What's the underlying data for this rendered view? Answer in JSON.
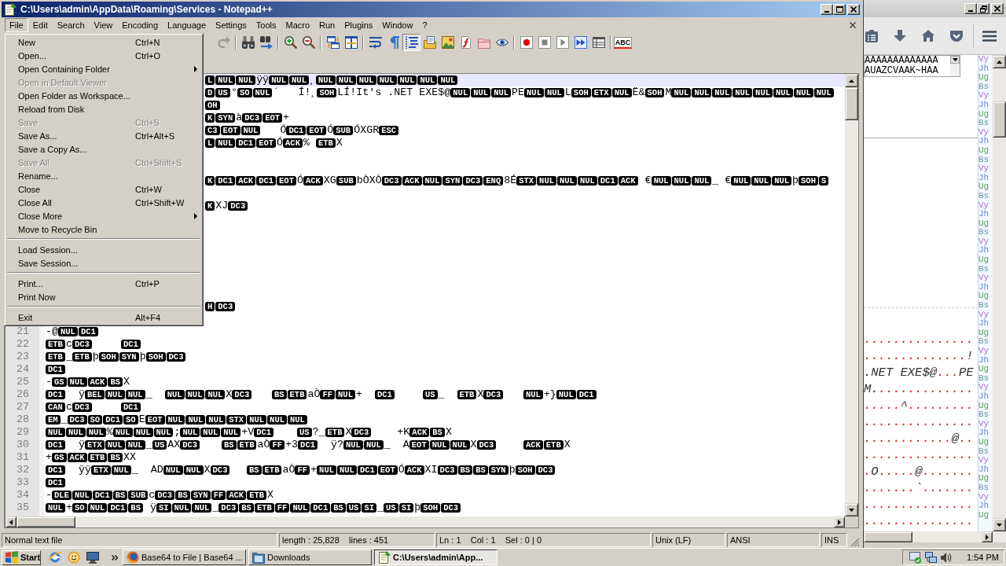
{
  "window": {
    "title": "C:\\Users\\admin\\AppData\\Roaming\\Services - Notepad++"
  },
  "menu_bar": [
    {
      "label": "File",
      "selected": true
    },
    {
      "label": "Edit",
      "selected": false
    },
    {
      "label": "Search",
      "selected": false
    },
    {
      "label": "View",
      "selected": false
    },
    {
      "label": "Encoding",
      "selected": false
    },
    {
      "label": "Language",
      "selected": false
    },
    {
      "label": "Settings",
      "selected": false
    },
    {
      "label": "Tools",
      "selected": false
    },
    {
      "label": "Macro",
      "selected": false
    },
    {
      "label": "Run",
      "selected": false
    },
    {
      "label": "Plugins",
      "selected": false
    },
    {
      "label": "Window",
      "selected": false
    },
    {
      "label": "?",
      "selected": false
    }
  ],
  "toolbar": [
    {
      "pressed": false,
      "disabled": true
    },
    {
      "pressed": false,
      "disabled": false
    },
    {
      "pressed": false,
      "disabled": false
    },
    {
      "pressed": false,
      "disabled": false
    },
    {
      "pressed": false,
      "disabled": false
    },
    {
      "pressed": false,
      "disabled": false
    },
    {
      "pressed": false,
      "disabled": false
    },
    {
      "pressed": false,
      "disabled": false
    },
    {
      "pressed": false,
      "disabled": false
    },
    {
      "pressed": true,
      "disabled": false
    },
    {
      "pressed": false,
      "disabled": false
    },
    {
      "pressed": false,
      "disabled": false
    },
    {
      "pressed": false,
      "disabled": false
    },
    {
      "pressed": false,
      "disabled": false
    },
    {
      "pressed": false,
      "disabled": false
    },
    {
      "pressed": false,
      "disabled": false
    },
    {
      "pressed": false,
      "disabled": false
    },
    {
      "pressed": false,
      "disabled": false
    },
    {
      "pressed": false,
      "disabled": false
    },
    {
      "pressed": false,
      "disabled": false
    },
    {
      "pressed": false,
      "disabled": false,
      "label": "ABC"
    }
  ],
  "file_menu": [
    {
      "kind": "item",
      "label": "New",
      "shortcut": "Ctrl+N",
      "disabled": false,
      "submenu": false
    },
    {
      "kind": "item",
      "label": "Open...",
      "shortcut": "Ctrl+O",
      "disabled": false,
      "submenu": false
    },
    {
      "kind": "item",
      "label": "Open Containing Folder",
      "disabled": false,
      "submenu": true
    },
    {
      "kind": "item",
      "label": "Open in Default Viewer",
      "disabled": true,
      "submenu": false
    },
    {
      "kind": "item",
      "label": "Open Folder as Workspace...",
      "disabled": false,
      "submenu": false
    },
    {
      "kind": "item",
      "label": "Reload from Disk",
      "disabled": false,
      "submenu": false
    },
    {
      "kind": "item",
      "label": "Save",
      "shortcut": "Ctrl+S",
      "disabled": true,
      "submenu": false
    },
    {
      "kind": "item",
      "label": "Save As...",
      "shortcut": "Ctrl+Alt+S",
      "disabled": false,
      "submenu": false
    },
    {
      "kind": "item",
      "label": "Save a Copy As...",
      "disabled": false,
      "submenu": false
    },
    {
      "kind": "item",
      "label": "Save All",
      "shortcut": "Ctrl+Shift+S",
      "disabled": true,
      "submenu": false
    },
    {
      "kind": "item",
      "label": "Rename...",
      "disabled": false,
      "submenu": false
    },
    {
      "kind": "item",
      "label": "Close",
      "shortcut": "Ctrl+W",
      "disabled": false,
      "submenu": false
    },
    {
      "kind": "item",
      "label": "Close All",
      "shortcut": "Ctrl+Shift+W",
      "disabled": false,
      "submenu": false
    },
    {
      "kind": "item",
      "label": "Close More",
      "disabled": false,
      "submenu": true
    },
    {
      "kind": "item",
      "label": "Move to Recycle Bin",
      "disabled": false,
      "submenu": false
    },
    {
      "kind": "separator"
    },
    {
      "kind": "item",
      "label": "Load Session...",
      "disabled": false,
      "submenu": false
    },
    {
      "kind": "item",
      "label": "Save Session...",
      "disabled": false,
      "submenu": false
    },
    {
      "kind": "separator"
    },
    {
      "kind": "item",
      "label": "Print...",
      "shortcut": "Ctrl+P",
      "disabled": false,
      "submenu": false
    },
    {
      "kind": "item",
      "label": "Print Now",
      "disabled": false,
      "submenu": false
    },
    {
      "kind": "separator"
    },
    {
      "kind": "item",
      "label": "Exit",
      "shortcut": "Alt+F4",
      "disabled": false,
      "submenu": false
    }
  ],
  "editor": {
    "lines": [
      {
        "current": true,
        "segments": [
          {
            "kind": "ctrl",
            "text": "L"
          },
          {
            "kind": "ctrl",
            "text": "NUL"
          },
          {
            "kind": "ctrl",
            "text": "NUL"
          },
          {
            "kind": "chars",
            "text": "ÿÿ"
          },
          {
            "kind": "ctrl",
            "text": "NUL"
          },
          {
            "kind": "ctrl",
            "text": "NUL"
          },
          {
            "kind": "chars",
            "text": "¸"
          },
          {
            "kind": "ctrl",
            "text": "NUL"
          },
          {
            "kind": "ctrl",
            "text": "NUL"
          },
          {
            "kind": "ctrl",
            "text": "NUL"
          },
          {
            "kind": "ctrl",
            "text": "NUL"
          },
          {
            "kind": "ctrl",
            "text": "NUL"
          },
          {
            "kind": "ctrl",
            "text": "NUL"
          },
          {
            "kind": "ctrl",
            "text": "NUL"
          }
        ]
      },
      {
        "current": false,
        "segments": [
          {
            "kind": "ctrl",
            "text": "D"
          },
          {
            "kind": "ctrl",
            "text": "US"
          },
          {
            "kind": "chars",
            "text": "°"
          },
          {
            "kind": "ctrl",
            "text": "SO"
          },
          {
            "kind": "ctrl",
            "text": "NUL"
          },
          {
            "kind": "chars",
            "text": "´   Í!¸"
          },
          {
            "kind": "ctrl",
            "text": "SOH"
          },
          {
            "kind": "chars",
            "text": "LÍ!It's .NET EXE$@"
          },
          {
            "kind": "ctrl",
            "text": "NUL"
          },
          {
            "kind": "ctrl",
            "text": "NUL"
          },
          {
            "kind": "ctrl",
            "text": "NUL"
          },
          {
            "kind": "chars",
            "text": "PE"
          },
          {
            "kind": "ctrl",
            "text": "NUL"
          },
          {
            "kind": "ctrl",
            "text": "NUL"
          },
          {
            "kind": "chars",
            "text": "L"
          },
          {
            "kind": "ctrl",
            "text": "SOH"
          },
          {
            "kind": "ctrl",
            "text": "ETX"
          },
          {
            "kind": "ctrl",
            "text": "NUL"
          },
          {
            "kind": "chars",
            "text": "Ë&"
          },
          {
            "kind": "ctrl",
            "text": "SOH"
          },
          {
            "kind": "chars",
            "text": "M"
          },
          {
            "kind": "ctrl",
            "text": "NUL"
          },
          {
            "kind": "ctrl",
            "text": "NUL"
          },
          {
            "kind": "ctrl",
            "text": "NUL"
          },
          {
            "kind": "ctrl",
            "text": "NUL"
          },
          {
            "kind": "ctrl",
            "text": "NUL"
          },
          {
            "kind": "ctrl",
            "text": "NUL"
          },
          {
            "kind": "ctrl",
            "text": "NUL"
          },
          {
            "kind": "ctrl",
            "text": "NUL"
          }
        ]
      },
      {
        "current": false,
        "segments": [
          {
            "kind": "ctrl",
            "text": "OH"
          }
        ]
      },
      {
        "current": false,
        "segments": [
          {
            "kind": "ctrl",
            "text": "K"
          },
          {
            "kind": "ctrl",
            "text": "SYN"
          },
          {
            "kind": "chars",
            "text": "à"
          },
          {
            "kind": "ctrl",
            "text": "DC3"
          },
          {
            "kind": "ctrl",
            "text": "EOT"
          },
          {
            "kind": "chars",
            "text": "+"
          }
        ]
      },
      {
        "current": false,
        "segments": [
          {
            "kind": "ctrl",
            "text": "C3"
          },
          {
            "kind": "ctrl",
            "text": "EOT"
          },
          {
            "kind": "ctrl",
            "text": "NUL"
          },
          {
            "kind": "chars",
            "text": "   Ó"
          },
          {
            "kind": "ctrl",
            "text": "DC1"
          },
          {
            "kind": "ctrl",
            "text": "EOT"
          },
          {
            "kind": "chars",
            "text": "Ó"
          },
          {
            "kind": "ctrl",
            "text": "SUB"
          },
          {
            "kind": "chars",
            "text": "ÓXGR"
          },
          {
            "kind": "ctrl",
            "text": "ESC"
          }
        ]
      },
      {
        "current": false,
        "segments": [
          {
            "kind": "ctrl",
            "text": "L"
          },
          {
            "kind": "ctrl",
            "text": "NUL"
          },
          {
            "kind": "ctrl",
            "text": "DC1"
          },
          {
            "kind": "ctrl",
            "text": "EOT"
          },
          {
            "kind": "chars",
            "text": "Ó"
          },
          {
            "kind": "ctrl",
            "text": "ACK"
          },
          {
            "kind": "chars",
            "text": "% "
          },
          {
            "kind": "ctrl",
            "text": "ETB"
          },
          {
            "kind": "chars",
            "text": "X"
          }
        ]
      },
      {
        "current": false
      },
      {
        "current": false
      },
      {
        "current": false,
        "segments": [
          {
            "kind": "ctrl",
            "text": "K"
          },
          {
            "kind": "ctrl",
            "text": "DC1"
          },
          {
            "kind": "ctrl",
            "text": "ACK"
          },
          {
            "kind": "ctrl",
            "text": "DC1"
          },
          {
            "kind": "ctrl",
            "text": "EOT"
          },
          {
            "kind": "chars",
            "text": "Ó"
          },
          {
            "kind": "ctrl",
            "text": "ACK"
          },
          {
            "kind": "chars",
            "text": "XG"
          },
          {
            "kind": "ctrl",
            "text": "SUB"
          },
          {
            "kind": "chars",
            "text": "bÒXÒ"
          },
          {
            "kind": "ctrl",
            "text": "DC3"
          },
          {
            "kind": "ctrl",
            "text": "ACK"
          },
          {
            "kind": "ctrl",
            "text": "NUL"
          },
          {
            "kind": "ctrl",
            "text": "SYN"
          },
          {
            "kind": "ctrl",
            "text": "DC3"
          },
          {
            "kind": "ctrl",
            "text": "ENQ"
          },
          {
            "kind": "chars",
            "text": "8É"
          },
          {
            "kind": "ctrl",
            "text": "STX"
          },
          {
            "kind": "ctrl",
            "text": "NUL"
          },
          {
            "kind": "ctrl",
            "text": "NUL"
          },
          {
            "kind": "ctrl",
            "text": "NUL"
          },
          {
            "kind": "ctrl",
            "text": "DC1"
          },
          {
            "kind": "ctrl",
            "text": "ACK"
          },
          {
            "kind": "chars",
            "text": " €"
          },
          {
            "kind": "ctrl",
            "text": "NUL"
          },
          {
            "kind": "ctrl",
            "text": "NUL"
          },
          {
            "kind": "ctrl",
            "text": "NUL"
          },
          {
            "kind": "chars",
            "text": "_ €"
          },
          {
            "kind": "ctrl",
            "text": "NUL"
          },
          {
            "kind": "ctrl",
            "text": "NUL"
          },
          {
            "kind": "ctrl",
            "text": "NUL"
          },
          {
            "kind": "chars",
            "text": "þ"
          },
          {
            "kind": "ctrl",
            "text": "SOH"
          },
          {
            "kind": "ctrl",
            "text": "S"
          }
        ]
      },
      {
        "current": false
      },
      {
        "current": false,
        "segments": [
          {
            "kind": "ctrl",
            "text": "K"
          },
          {
            "kind": "chars",
            "text": "XJ"
          },
          {
            "kind": "ctrl",
            "text": "DC3"
          }
        ]
      },
      {
        "current": false
      },
      {
        "current": false
      },
      {
        "current": false
      },
      {
        "current": false
      },
      {
        "current": false
      },
      {
        "current": false
      },
      {
        "current": false
      },
      {
        "current": false,
        "segments": [
          {
            "kind": "ctrl",
            "text": "H"
          },
          {
            "kind": "ctrl",
            "text": "DC3"
          }
        ]
      },
      {
        "current": false
      },
      {
        "number": "21",
        "current": false,
        "segments": [
          {
            "kind": "chars",
            "text": "-@"
          },
          {
            "kind": "ctrl",
            "text": "NUL"
          },
          {
            "kind": "ctrl",
            "text": "DC1"
          }
        ]
      },
      {
        "number": "22",
        "current": false,
        "segments": [
          {
            "kind": "ctrl",
            "text": "ETB"
          },
          {
            "kind": "chars",
            "text": "c"
          },
          {
            "kind": "ctrl",
            "text": "DC3"
          },
          {
            "kind": "tab"
          },
          {
            "kind": "tab"
          },
          {
            "kind": "ctrl",
            "text": "DC1"
          }
        ]
      },
      {
        "number": "23",
        "current": false,
        "segments": [
          {
            "kind": "ctrl",
            "text": "ETB"
          },
          {
            "kind": "chars",
            "text": "_"
          },
          {
            "kind": "ctrl",
            "text": "ETB"
          },
          {
            "kind": "chars",
            "text": "þ"
          },
          {
            "kind": "ctrl",
            "text": "SOH"
          },
          {
            "kind": "ctrl",
            "text": "SYN"
          },
          {
            "kind": "chars",
            "text": "þ"
          },
          {
            "kind": "ctrl",
            "text": "SOH"
          },
          {
            "kind": "ctrl",
            "text": "DC3"
          }
        ]
      },
      {
        "number": "24",
        "current": false,
        "segments": [
          {
            "kind": "ctrl",
            "text": "DC1"
          }
        ]
      },
      {
        "number": "25",
        "current": false,
        "segments": [
          {
            "kind": "chars",
            "text": "-"
          },
          {
            "kind": "ctrl",
            "text": "GS"
          },
          {
            "kind": "ctrl",
            "text": "NUL"
          },
          {
            "kind": "ctrl",
            "text": "ACK"
          },
          {
            "kind": "ctrl",
            "text": "BS"
          },
          {
            "kind": "chars",
            "text": "X"
          }
        ]
      },
      {
        "number": "26",
        "current": false,
        "segments": [
          {
            "kind": "ctrl",
            "text": "DC1"
          },
          {
            "kind": "chars",
            "text": "  ÿ"
          },
          {
            "kind": "ctrl",
            "text": "BEL"
          },
          {
            "kind": "ctrl",
            "text": "NUL"
          },
          {
            "kind": "ctrl",
            "text": "NUL"
          },
          {
            "kind": "chars",
            "text": "_  "
          },
          {
            "kind": "ctrl",
            "text": "NUL"
          },
          {
            "kind": "ctrl",
            "text": "NUL"
          },
          {
            "kind": "ctrl",
            "text": "NUL"
          },
          {
            "kind": "chars",
            "text": "X"
          },
          {
            "kind": "ctrl",
            "text": "DC3"
          },
          {
            "kind": "tab"
          },
          {
            "kind": "ctrl",
            "text": "BS"
          },
          {
            "kind": "ctrl",
            "text": "ETB"
          },
          {
            "kind": "chars",
            "text": "aÒ"
          },
          {
            "kind": "ctrl",
            "text": "FF"
          },
          {
            "kind": "ctrl",
            "text": "NUL"
          },
          {
            "kind": "chars",
            "text": "+  "
          },
          {
            "kind": "ctrl",
            "text": "DC1"
          },
          {
            "kind": "tab"
          },
          {
            "kind": "ctrl",
            "text": "US"
          },
          {
            "kind": "chars",
            "text": "_  "
          },
          {
            "kind": "ctrl",
            "text": "ETB"
          },
          {
            "kind": "chars",
            "text": "X"
          },
          {
            "kind": "ctrl",
            "text": "DC3"
          },
          {
            "kind": "tab"
          },
          {
            "kind": "ctrl",
            "text": "NUL"
          },
          {
            "kind": "chars",
            "text": "+}"
          },
          {
            "kind": "ctrl",
            "text": "NUL"
          },
          {
            "kind": "ctrl",
            "text": "DC1"
          }
        ]
      },
      {
        "number": "27",
        "current": false,
        "segments": [
          {
            "kind": "ctrl",
            "text": "CAN"
          },
          {
            "kind": "chars",
            "text": "c"
          },
          {
            "kind": "ctrl",
            "text": "DC3"
          },
          {
            "kind": "tab"
          },
          {
            "kind": "tab"
          },
          {
            "kind": "ctrl",
            "text": "DC1"
          }
        ]
      },
      {
        "number": "28",
        "current": false,
        "segments": [
          {
            "kind": "ctrl",
            "text": "EM"
          },
          {
            "kind": "chars",
            "text": "_"
          },
          {
            "kind": "ctrl",
            "text": "DC3"
          },
          {
            "kind": "ctrl",
            "text": "SO"
          },
          {
            "kind": "ctrl",
            "text": "DC1"
          },
          {
            "kind": "ctrl",
            "text": "SO"
          },
          {
            "kind": "chars",
            "text": "E"
          },
          {
            "kind": "ctrl",
            "text": "EOT"
          },
          {
            "kind": "ctrl",
            "text": "NUL"
          },
          {
            "kind": "ctrl",
            "text": "NUL"
          },
          {
            "kind": "ctrl",
            "text": "NUL"
          },
          {
            "kind": "ctrl",
            "text": "STX"
          },
          {
            "kind": "ctrl",
            "text": "NUL"
          },
          {
            "kind": "ctrl",
            "text": "NUL"
          },
          {
            "kind": "ctrl",
            "text": "NUL"
          }
        ]
      },
      {
        "number": "29",
        "current": false,
        "segments": [
          {
            "kind": "ctrl",
            "text": "NUL"
          },
          {
            "kind": "ctrl",
            "text": "NUL"
          },
          {
            "kind": "ctrl",
            "text": "NUL"
          },
          {
            "kind": "chars",
            "text": "%"
          },
          {
            "kind": "ctrl",
            "text": "NUL"
          },
          {
            "kind": "ctrl",
            "text": "NUL"
          },
          {
            "kind": "ctrl",
            "text": "NUL"
          },
          {
            "kind": "chars",
            "text": ";"
          },
          {
            "kind": "ctrl",
            "text": "NUL"
          },
          {
            "kind": "ctrl",
            "text": "NUL"
          },
          {
            "kind": "ctrl",
            "text": "NUL"
          },
          {
            "kind": "chars",
            "text": "+V"
          },
          {
            "kind": "ctrl",
            "text": "DC1"
          },
          {
            "kind": "tab"
          },
          {
            "kind": "ctrl",
            "text": "US"
          },
          {
            "kind": "chars",
            "text": "?_"
          },
          {
            "kind": "ctrl",
            "text": "ETB"
          },
          {
            "kind": "chars",
            "text": "X"
          },
          {
            "kind": "ctrl",
            "text": "DC3"
          },
          {
            "kind": "chars",
            "text": "    +K"
          },
          {
            "kind": "ctrl",
            "text": "ACK"
          },
          {
            "kind": "ctrl",
            "text": "BS"
          },
          {
            "kind": "chars",
            "text": "X"
          }
        ]
      },
      {
        "number": "30",
        "current": false,
        "segments": [
          {
            "kind": "ctrl",
            "text": "DC1"
          },
          {
            "kind": "chars",
            "text": "  ÿ"
          },
          {
            "kind": "ctrl",
            "text": "ETX"
          },
          {
            "kind": "ctrl",
            "text": "NUL"
          },
          {
            "kind": "ctrl",
            "text": "NUL"
          },
          {
            "kind": "chars",
            "text": "_"
          },
          {
            "kind": "ctrl",
            "text": "US"
          },
          {
            "kind": "chars",
            "text": "AX"
          },
          {
            "kind": "ctrl",
            "text": "DC3"
          },
          {
            "kind": "tab"
          },
          {
            "kind": "ctrl",
            "text": "BS"
          },
          {
            "kind": "ctrl",
            "text": "ETB"
          },
          {
            "kind": "chars",
            "text": "aÒ"
          },
          {
            "kind": "ctrl",
            "text": "FF"
          },
          {
            "kind": "chars",
            "text": "+3"
          },
          {
            "kind": "ctrl",
            "text": "DC1"
          },
          {
            "kind": "chars",
            "text": "  ÿ?"
          },
          {
            "kind": "ctrl",
            "text": "NUL"
          },
          {
            "kind": "ctrl",
            "text": "NUL"
          },
          {
            "kind": "chars",
            "text": "_  A"
          },
          {
            "kind": "ctrl",
            "text": "EOT"
          },
          {
            "kind": "ctrl",
            "text": "NUL"
          },
          {
            "kind": "ctrl",
            "text": "NUL"
          },
          {
            "kind": "chars",
            "text": "X"
          },
          {
            "kind": "ctrl",
            "text": "DC3"
          },
          {
            "kind": "tab"
          },
          {
            "kind": "ctrl",
            "text": "ACK"
          },
          {
            "kind": "ctrl",
            "text": "ETB"
          },
          {
            "kind": "chars",
            "text": "X"
          }
        ]
      },
      {
        "number": "31",
        "current": false,
        "segments": [
          {
            "kind": "chars",
            "text": "+"
          },
          {
            "kind": "ctrl",
            "text": "GS"
          },
          {
            "kind": "ctrl",
            "text": "ACK"
          },
          {
            "kind": "ctrl",
            "text": "ETB"
          },
          {
            "kind": "ctrl",
            "text": "BS"
          },
          {
            "kind": "chars",
            "text": "XX"
          }
        ]
      },
      {
        "number": "32",
        "current": false,
        "segments": [
          {
            "kind": "ctrl",
            "text": "DC1"
          },
          {
            "kind": "chars",
            "text": "  ÿÿ"
          },
          {
            "kind": "ctrl",
            "text": "ETX"
          },
          {
            "kind": "ctrl",
            "text": "NUL"
          },
          {
            "kind": "chars",
            "text": "_  AD"
          },
          {
            "kind": "ctrl",
            "text": "NUL"
          },
          {
            "kind": "ctrl",
            "text": "NUL"
          },
          {
            "kind": "chars",
            "text": "X"
          },
          {
            "kind": "ctrl",
            "text": "DC3"
          },
          {
            "kind": "tab"
          },
          {
            "kind": "ctrl",
            "text": "BS"
          },
          {
            "kind": "ctrl",
            "text": "ETB"
          },
          {
            "kind": "chars",
            "text": "aÒ"
          },
          {
            "kind": "ctrl",
            "text": "FF"
          },
          {
            "kind": "chars",
            "text": "+"
          },
          {
            "kind": "ctrl",
            "text": "NUL"
          },
          {
            "kind": "ctrl",
            "text": "NUL"
          },
          {
            "kind": "ctrl",
            "text": "DC1"
          },
          {
            "kind": "ctrl",
            "text": "EOT"
          },
          {
            "kind": "chars",
            "text": "Ó"
          },
          {
            "kind": "ctrl",
            "text": "ACK"
          },
          {
            "kind": "chars",
            "text": "XI"
          },
          {
            "kind": "ctrl",
            "text": "DC3"
          },
          {
            "kind": "ctrl",
            "text": "BS"
          },
          {
            "kind": "ctrl",
            "text": "BS"
          },
          {
            "kind": "ctrl",
            "text": "SYN"
          },
          {
            "kind": "chars",
            "text": "þ"
          },
          {
            "kind": "ctrl",
            "text": "SOH"
          },
          {
            "kind": "ctrl",
            "text": "DC3"
          }
        ]
      },
      {
        "number": "33",
        "current": false,
        "segments": [
          {
            "kind": "ctrl",
            "text": "DC1"
          }
        ]
      },
      {
        "number": "34",
        "current": false,
        "segments": [
          {
            "kind": "chars",
            "text": "-"
          },
          {
            "kind": "ctrl",
            "text": "DLE"
          },
          {
            "kind": "ctrl",
            "text": "NUL"
          },
          {
            "kind": "ctrl",
            "text": "DC1"
          },
          {
            "kind": "ctrl",
            "text": "BS"
          },
          {
            "kind": "ctrl",
            "text": "SUB"
          },
          {
            "kind": "chars",
            "text": "c"
          },
          {
            "kind": "ctrl",
            "text": "DC3"
          },
          {
            "kind": "ctrl",
            "text": "BS"
          },
          {
            "kind": "ctrl",
            "text": "SYN"
          },
          {
            "kind": "ctrl",
            "text": "FF"
          },
          {
            "kind": "ctrl",
            "text": "ACK"
          },
          {
            "kind": "ctrl",
            "text": "ETB"
          },
          {
            "kind": "chars",
            "text": "X"
          }
        ]
      },
      {
        "number": "35",
        "current": false,
        "segments": [
          {
            "kind": "ctrl",
            "text": "NUL"
          },
          {
            "kind": "chars",
            "text": "+"
          },
          {
            "kind": "ctrl",
            "text": "SO"
          },
          {
            "kind": "ctrl",
            "text": "NUL"
          },
          {
            "kind": "ctrl",
            "text": "DC1"
          },
          {
            "kind": "ctrl",
            "text": "BS"
          },
          {
            "kind": "chars",
            "text": " ÿ"
          },
          {
            "kind": "ctrl",
            "text": "SI"
          },
          {
            "kind": "ctrl",
            "text": "NUL"
          },
          {
            "kind": "ctrl",
            "text": "NUL"
          },
          {
            "kind": "chars",
            "text": "_"
          },
          {
            "kind": "ctrl",
            "text": "DC3"
          },
          {
            "kind": "ctrl",
            "text": "BS"
          },
          {
            "kind": "ctrl",
            "text": "ETB"
          },
          {
            "kind": "ctrl",
            "text": "FF"
          },
          {
            "kind": "ctrl",
            "text": "NUL"
          },
          {
            "kind": "ctrl",
            "text": "DC1"
          },
          {
            "kind": "ctrl",
            "text": "BS"
          },
          {
            "kind": "ctrl",
            "text": "US"
          },
          {
            "kind": "ctrl",
            "text": "SI"
          },
          {
            "kind": "chars",
            "text": "_"
          },
          {
            "kind": "ctrl",
            "text": "US"
          },
          {
            "kind": "ctrl",
            "text": "SI"
          },
          {
            "kind": "chars",
            "text": "þ"
          },
          {
            "kind": "ctrl",
            "text": "SOH"
          },
          {
            "kind": "ctrl",
            "text": "DC3"
          }
        ]
      }
    ]
  },
  "status_bar": {
    "file_type": "Normal text file",
    "length": "length : 25,828    lines : 451",
    "position": "Ln : 1    Col : 1    Sel : 0 | 0",
    "line_ending": "Unix (LF)",
    "encoding": "ANSI",
    "mode": "INS"
  },
  "browser": {
    "text_box": [
      "AAAAAAAAAAAAA",
      "AUAZCVAAK~HAA"
    ],
    "dump_rows": [
      {
        "segments": [
          {
            "kind": "dots",
            "text": "..............."
          }
        ]
      },
      {
        "segments": [
          {
            "kind": "dots",
            "text": ".............."
          },
          {
            "kind": "chars",
            "text": "!"
          }
        ]
      },
      {
        "segments": [
          {
            "kind": "chars",
            "text": ".NET EXE$@"
          },
          {
            "kind": "dots",
            "text": "..."
          },
          {
            "kind": "chars",
            "text": "PE"
          }
        ]
      },
      {
        "segments": [
          {
            "kind": "chars",
            "text": "M."
          },
          {
            "kind": "dots",
            "text": "............."
          }
        ]
      },
      {
        "segments": [
          {
            "kind": "dots",
            "text": "....."
          },
          {
            "kind": "chars",
            "text": "^"
          },
          {
            "kind": "dots",
            "text": "........."
          }
        ]
      },
      {
        "segments": [
          {
            "kind": "dots",
            "text": "..............."
          }
        ]
      },
      {
        "segments": [
          {
            "kind": "dots",
            "text": "............"
          },
          {
            "kind": "chars",
            "text": "@"
          },
          {
            "kind": "dots",
            "text": ".."
          }
        ]
      },
      {
        "segments": [
          {
            "kind": "dots",
            "text": "..............."
          }
        ]
      },
      {
        "segments": [
          {
            "kind": "dots",
            "text": "."
          },
          {
            "kind": "chars",
            "text": "O"
          },
          {
            "kind": "dots",
            "text": "....."
          },
          {
            "kind": "chars",
            "text": "@"
          },
          {
            "kind": "dots",
            "text": "......."
          }
        ]
      },
      {
        "segments": [
          {
            "kind": "dots",
            "text": "......."
          },
          {
            "kind": "chars",
            "text": "`"
          },
          {
            "kind": "dots",
            "text": "......."
          }
        ]
      },
      {
        "segments": [
          {
            "kind": "dots",
            "text": "..............."
          }
        ]
      },
      {
        "segments": [
          {
            "kind": "dots",
            "text": "..............."
          }
        ]
      }
    ],
    "colored_column": [
      {
        "text": "Vy",
        "color": "#b070c8"
      },
      {
        "text": "Jh",
        "color": "#6a88d0"
      },
      {
        "text": "Ug",
        "color": "#5aa85a"
      },
      {
        "text": "Bs",
        "color": "#6898a8"
      },
      {
        "text": "Vy",
        "color": "#b070c8"
      },
      {
        "text": "Jh",
        "color": "#6a88d0"
      },
      {
        "text": "Ug",
        "color": "#5aa85a"
      },
      {
        "text": "Bs",
        "color": "#6898a8"
      },
      {
        "text": "Vy",
        "color": "#b070c8"
      },
      {
        "text": "Jh",
        "color": "#6a88d0"
      },
      {
        "text": "Ug",
        "color": "#5aa85a"
      },
      {
        "text": "Bs",
        "color": "#6898a8"
      },
      {
        "text": "Vy",
        "color": "#b070c8"
      },
      {
        "text": "Jh",
        "color": "#6a88d0"
      },
      {
        "text": "Ug",
        "color": "#5aa85a"
      },
      {
        "text": "Bs",
        "color": "#6898a8"
      },
      {
        "text": "Vy",
        "color": "#b070c8"
      },
      {
        "text": "Jh",
        "color": "#6a88d0"
      },
      {
        "text": "Ug",
        "color": "#5aa85a"
      },
      {
        "text": "Bs",
        "color": "#6898a8"
      },
      {
        "text": "Vy",
        "color": "#b070c8"
      },
      {
        "text": "Jh",
        "color": "#6a88d0"
      },
      {
        "text": "Ug",
        "color": "#5aa85a"
      },
      {
        "text": "Bs",
        "color": "#6898a8"
      },
      {
        "text": "Vy",
        "color": "#b070c8"
      },
      {
        "text": "Jh",
        "color": "#6a88d0"
      },
      {
        "text": "Ug",
        "color": "#5aa85a"
      },
      {
        "text": "Bs",
        "color": "#6898a8"
      },
      {
        "text": "Vy",
        "color": "#b070c8"
      },
      {
        "text": "Jh",
        "color": "#6a88d0"
      },
      {
        "text": "Ug",
        "color": "#5aa85a"
      },
      {
        "text": "Bs",
        "color": "#6898a8"
      },
      {
        "text": "Vy",
        "color": "#b070c8"
      },
      {
        "text": "Jh",
        "color": "#6a88d0"
      },
      {
        "text": "Ug",
        "color": "#5aa85a"
      },
      {
        "text": "Bs",
        "color": "#6898a8"
      },
      {
        "text": "Vy",
        "color": "#b070c8"
      },
      {
        "text": "Jh",
        "color": "#6a88d0"
      },
      {
        "text": "Ug",
        "color": "#5aa85a"
      },
      {
        "text": "Bs",
        "color": "#6898a8"
      },
      {
        "text": "Vy",
        "color": "#b070c8"
      },
      {
        "text": "Jh",
        "color": "#6a88d0"
      },
      {
        "text": "Ug",
        "color": "#5aa85a"
      },
      {
        "text": "Bs",
        "color": "#6898a8"
      },
      {
        "text": "Vy",
        "color": "#b070c8"
      },
      {
        "text": "Jh",
        "color": "#6a88d0"
      },
      {
        "text": "Ug",
        "color": "#5aa85a"
      },
      {
        "text": "Bs",
        "color": "#6898a8"
      },
      {
        "text": "Vy",
        "color": "#b070c8"
      },
      {
        "text": "Jh",
        "color": "#6a88d0"
      },
      {
        "text": "Ug",
        "color": "#5aa85a"
      }
    ]
  },
  "taskbar": {
    "start": "Start",
    "tasks": [
      {
        "label": "Base64 to File | Base64 ...",
        "selected": false
      },
      {
        "label": "Downloads",
        "selected": false
      },
      {
        "label": "C:\\Users\\admin\\App...",
        "selected": true
      }
    ],
    "clock": "1:54 PM"
  }
}
